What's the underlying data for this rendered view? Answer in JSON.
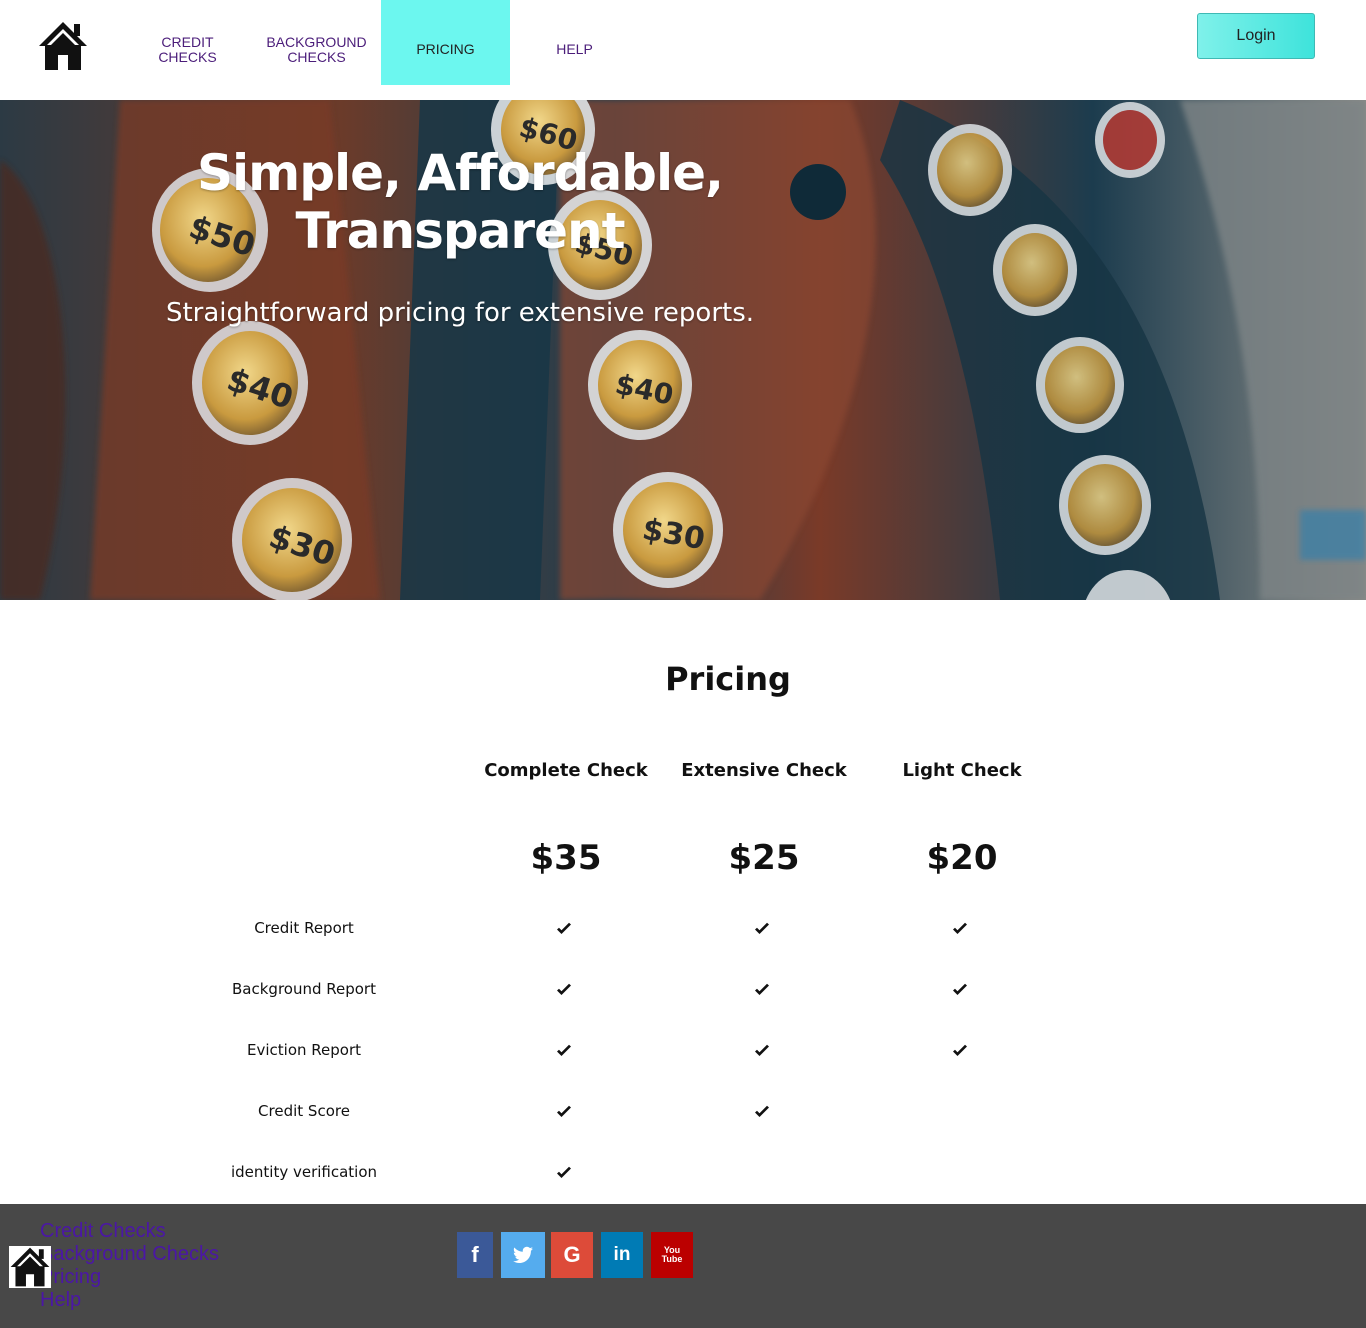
{
  "header": {
    "logo_icon": "home-icon",
    "nav": [
      {
        "label_line1": "CREDIT",
        "label_line2": "CHECKS",
        "active": false
      },
      {
        "label_line1": "BACKGROUND",
        "label_line2": "CHECKS",
        "active": false
      },
      {
        "label_line1": "PRICING",
        "label_line2": "",
        "active": true
      },
      {
        "label_line1": "HELP",
        "label_line2": "",
        "active": false
      }
    ],
    "login_label": "Login"
  },
  "hero": {
    "title_line1": "Simple, Affordable,",
    "title_line2": "Transparent",
    "subtitle": "Straightforward pricing for extensive reports.",
    "image_description_keys": [
      "$60",
      "$50",
      "$50",
      "$40",
      "$40",
      "$30",
      "$30"
    ]
  },
  "pricing": {
    "title": "Pricing",
    "plans": [
      {
        "name": "Complete Check",
        "price": "$35"
      },
      {
        "name": "Extensive Check",
        "price": "$25"
      },
      {
        "name": "Light Check",
        "price": "$20"
      }
    ],
    "features": [
      {
        "label": "Credit Report",
        "included": [
          true,
          true,
          true
        ]
      },
      {
        "label": "Background Report",
        "included": [
          true,
          true,
          true
        ]
      },
      {
        "label": "Eviction Report",
        "included": [
          true,
          true,
          true
        ]
      },
      {
        "label": "Credit Score",
        "included": [
          true,
          true,
          false
        ]
      },
      {
        "label": "identity verification",
        "included": [
          true,
          false,
          false
        ]
      }
    ]
  },
  "footer": {
    "links": [
      "Credit Checks",
      "Background Checks",
      "Pricing",
      "Help"
    ],
    "social": [
      {
        "icon": "facebook-icon",
        "glyph": "f",
        "color": "#3b5998"
      },
      {
        "icon": "twitter-icon",
        "glyph": "t",
        "color": "#55acee"
      },
      {
        "icon": "google-icon",
        "glyph": "G",
        "color": "#dd4b39"
      },
      {
        "icon": "linkedin-icon",
        "glyph": "in",
        "color": "#007bb5"
      },
      {
        "icon": "youtube-icon",
        "glyph": "You Tube",
        "color": "#bb0000"
      }
    ],
    "background_color": "#484848"
  },
  "colors": {
    "nav_text": "#4b1d7a",
    "nav_active_bg": "#6cf7ef",
    "login_gradient_start": "#7ff1ea",
    "login_gradient_end": "#3ee3db"
  }
}
